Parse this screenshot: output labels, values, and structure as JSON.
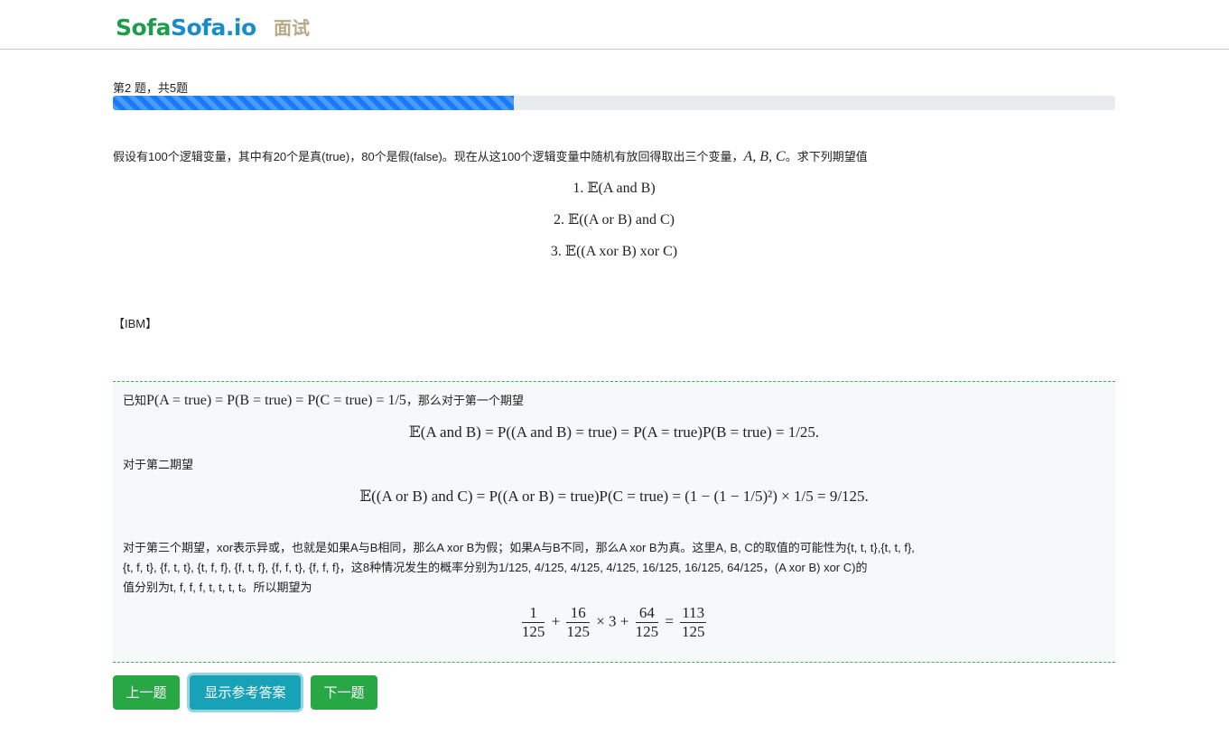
{
  "header": {
    "logo_part1": "S",
    "logo_part2": "o",
    "logo_part3": "fa",
    "logo_part4": "Sofa.io",
    "nav_title": "面试"
  },
  "progress": {
    "label": "第2 题，共5题",
    "current": 2,
    "total": 5,
    "fraction": 0.4
  },
  "question": {
    "intro": "假设有100个逻辑变量，其中有20个是真(true)，80个是假(false)。现在从这100个逻辑变量中随机有放回得取出三个变量，",
    "vars": "A, B, C",
    "intro_end": "。求下列期望值",
    "items": [
      "1. 𝔼(A and B)",
      "2. 𝔼((A or B) and C)",
      "3. 𝔼((A xor B) xor C)"
    ]
  },
  "source": "【IBM】",
  "answer": {
    "line1_prefix": "已知",
    "line1_math": "P(A = true) = P(B = true) = P(C = true) = 1/5",
    "line1_suffix": "，那么对于第一个期望",
    "eq1": "𝔼(A and B) = P((A and B) = true) = P(A = true)P(B = true) = 1/25.",
    "line2": "对于第二期望",
    "eq2": "𝔼((A or B) and C) = P((A or B) = true)P(C = true) = (1 − (1 − 1/5)²) × 1/5 = 9/125.",
    "para3_a": "对于第三个期望，xor表示异或，也就是如果A与B相同，那么A xor B为假；如果A与B不同，那么A xor B为真。这里A, B, C的取值的可能性为{t, t, t},{t, t, f},",
    "para3_b": "{t, f, t}, {f, t, t}, {t, f, f}, {f, t, f}, {f, f, t}, {f, f, f}，这8种情况发生的概率分别为1/125, 4/125, 4/125, 4/125, 16/125, 16/125, 64/125，(A xor B) xor C)的",
    "para3_c": "值分别为t, f, f, f, t, t, t, t。所以期望为",
    "final": {
      "f1_num": "1",
      "f1_den": "125",
      "plus1": "+",
      "f2_num": "16",
      "f2_den": "125",
      "times": "× 3 +",
      "f3_num": "64",
      "f3_den": "125",
      "eq": "=",
      "f4_num": "113",
      "f4_den": "125"
    }
  },
  "buttons": {
    "prev": "上一题",
    "show": "显示参考答案",
    "next": "下一题"
  },
  "colors": {
    "progress": "#1a7cf4",
    "green_button": "#28a745",
    "cyan_button": "#17a2b8",
    "answer_border": "#3fae5c"
  }
}
